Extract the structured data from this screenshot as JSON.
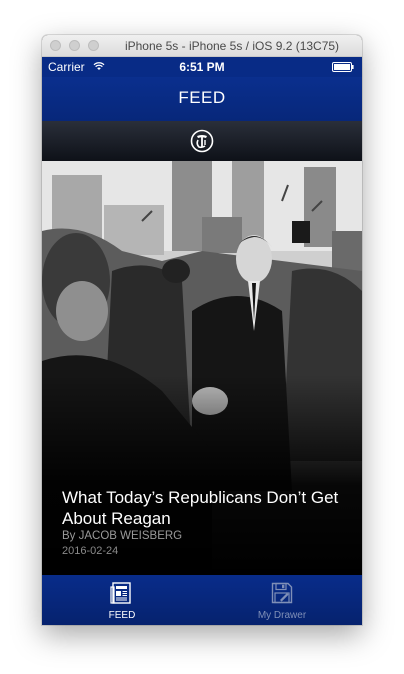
{
  "window": {
    "title": "iPhone 5s - iPhone 5s / iOS 9.2 (13C75)"
  },
  "status_bar": {
    "carrier": "Carrier",
    "time": "6:51 PM",
    "wifi_icon": "wifi-icon",
    "battery_icon": "battery-icon"
  },
  "nav": {
    "title": "FEED"
  },
  "source": {
    "icon": "new-york-times-logo-icon"
  },
  "article": {
    "headline": "What Today’s Republicans Don’t Get About Reagan",
    "byline": "By JACOB WEISBERG",
    "date": "2016-02-24"
  },
  "tabs": [
    {
      "label": "FEED",
      "icon": "newspaper-icon",
      "selected": true
    },
    {
      "label": "My Drawer",
      "icon": "floppy-disk-icon",
      "selected": false
    }
  ],
  "colors": {
    "bar_blue": "#0a2f8e",
    "tab_selected": "#ffffff",
    "tab_unselected": "#7f8fb7"
  }
}
